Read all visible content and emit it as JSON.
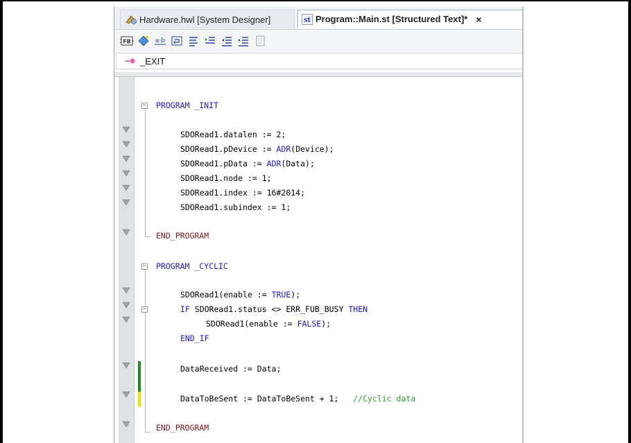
{
  "tabs": [
    {
      "label": "Hardware.hwl [System Designer]",
      "active": false,
      "icon": "hardware-designer-icon"
    },
    {
      "label": "Program::Main.st [Structured Text]*",
      "active": true,
      "icon": "structured-text-icon",
      "close": "×"
    }
  ],
  "toolbar": {
    "buttons": [
      "fb-icon",
      "diamond-icon",
      "ab-icon",
      "insert-icon",
      "list-icon",
      "outdent-icon",
      "indent-left-icon",
      "indent-right-icon",
      "page-icon"
    ]
  },
  "program_selector": {
    "value": "_EXIT",
    "icon": "program-icon"
  },
  "colors": {
    "keyword": "#1a1acb",
    "comment": "#2a9a2a",
    "green_marker": "#1f8a1f",
    "yellow_marker": "#e6e600"
  },
  "code": {
    "l1": "PROGRAM _INIT",
    "l2a": "SDORead1.datalen := 2;",
    "l3a": "SDORead1.pDevice := ",
    "l3b": "ADR",
    "l3c": "(Device);",
    "l4a": "SDORead1.pData := ",
    "l4b": "ADR",
    "l4c": "(Data);",
    "l5": "SDORead1.node := 1;",
    "l6": "SDORead1.index := 16#2014;",
    "l7": "SDORead1.subindex := 1;",
    "l8": "END_PROGRAM",
    "l9": "PROGRAM _CYCLIC",
    "l10a": "SDORead1(enable := ",
    "l10b": "TRUE",
    "l10c": ");",
    "l11a": "IF",
    "l11b": " SDORead1.status <> ERR_FUB_BUSY ",
    "l11c": "THEN",
    "l12a": "SDORead1(enable := ",
    "l12b": "FALSE",
    "l12c": ");",
    "l13": "END_IF",
    "l14": "DataReceived := Data;",
    "l15a": "DataToBeSent := DataToBeSent + 1;   ",
    "l15b": "//Cyclic data",
    "l16": "END_PROGRAM"
  }
}
